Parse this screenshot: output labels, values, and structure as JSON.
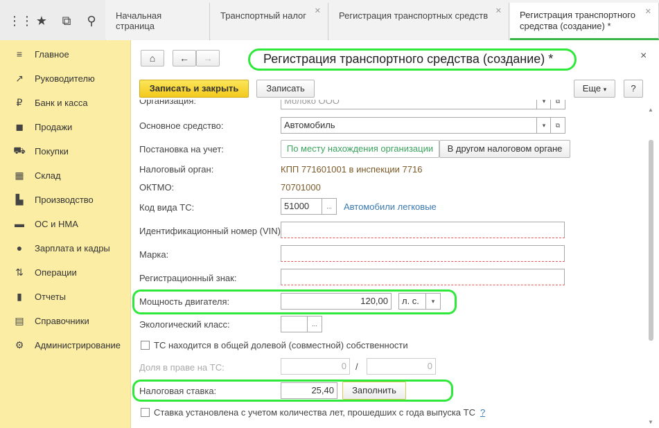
{
  "tabs": [
    {
      "label": "Начальная страница",
      "closable": false
    },
    {
      "label": "Транспортный налог",
      "closable": true
    },
    {
      "label": "Регистрация транспортных средств",
      "closable": true
    },
    {
      "label_line1": "Регистрация транспортного",
      "label_line2": "средства (создание) *",
      "closable": true
    }
  ],
  "sidebar": {
    "items": [
      {
        "label": "Главное",
        "icon": "menu-icon"
      },
      {
        "label": "Руководителю",
        "icon": "trend-icon"
      },
      {
        "label": "Банк и касса",
        "icon": "ruble-icon"
      },
      {
        "label": "Продажи",
        "icon": "bag-icon"
      },
      {
        "label": "Покупки",
        "icon": "cart-icon"
      },
      {
        "label": "Склад",
        "icon": "warehouse-icon"
      },
      {
        "label": "Производство",
        "icon": "factory-icon"
      },
      {
        "label": "ОС и НМА",
        "icon": "truck-icon"
      },
      {
        "label": "Зарплата и кадры",
        "icon": "person-icon"
      },
      {
        "label": "Операции",
        "icon": "operations-icon"
      },
      {
        "label": "Отчеты",
        "icon": "barchart-icon"
      },
      {
        "label": "Справочники",
        "icon": "book-icon"
      },
      {
        "label": "Администрирование",
        "icon": "gear-icon"
      }
    ]
  },
  "form": {
    "title": "Регистрация транспортного средства (создание) *",
    "close": "×",
    "save_close": "Записать и закрыть",
    "save": "Записать",
    "more": "Еще",
    "help": "?",
    "cut_label": "Организация:",
    "cut_value": "Молоко ООО",
    "asset_label": "Основное средство:",
    "asset_value": "Автомобиль",
    "reg_label": "Постановка на учет:",
    "reg_opt1": "По месту нахождения организации",
    "reg_opt2": "В другом налоговом органе",
    "tax_office_label": "Налоговый орган:",
    "tax_office_value": "КПП 771601001 в инспекции 7716",
    "oktmo_label": "ОКТМО:",
    "oktmo_value": "70701000",
    "ts_code_label": "Код вида ТС:",
    "ts_code_value": "51000",
    "ts_code_desc": "Автомобили легковые",
    "vin_label": "Идентификационный номер (VIN):",
    "brand_label": "Марка:",
    "plate_label": "Регистрационный знак:",
    "power_label": "Мощность двигателя:",
    "power_value": "120,00",
    "power_unit": "л. с.",
    "eco_label": "Экологический класс:",
    "shared_label": "ТС находится в общей долевой (совместной) собственности",
    "share_label": "Доля в праве на ТС:",
    "share_num": "0",
    "share_sep": "/",
    "share_den": "0",
    "rate_label": "Налоговая ставка:",
    "rate_value": "25,40",
    "fill_button": "Заполнить",
    "years_label": "Ставка установлена с учетом количества лет, прошедших с года выпуска ТС",
    "years_help": "?"
  },
  "colors": {
    "sidebar_bg": "#fbeda4",
    "primary_button": "#f4c91c",
    "highlight": "#2ee83a",
    "link": "#3a79b0",
    "value_text": "#7b5a2a"
  }
}
